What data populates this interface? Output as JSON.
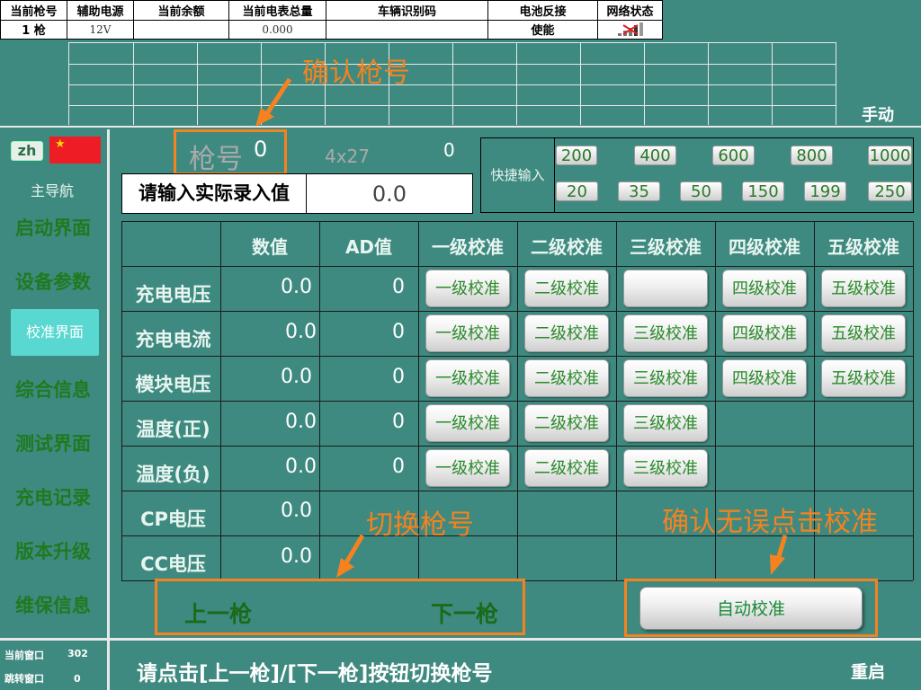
{
  "status": {
    "headers": [
      "当前枪号",
      "辅助电源",
      "当前余额",
      "当前电表总量",
      "车辆识别码",
      "电池反接",
      "网络状态"
    ],
    "gun": "1   枪",
    "aux_power": "12V",
    "balance": "",
    "meter_total": "0.000",
    "vin": "",
    "battery_reverse": "使能"
  },
  "upper": {
    "mode": "手动"
  },
  "sidebar": {
    "lang": "zh",
    "title": "主导航",
    "items": [
      {
        "label": "启动界面"
      },
      {
        "label": "设备参数"
      },
      {
        "label": "校准界面"
      },
      {
        "label": "综合信息"
      },
      {
        "label": "测试界面"
      },
      {
        "label": "充电记录"
      },
      {
        "label": "版本升级"
      },
      {
        "label": "维保信息"
      }
    ]
  },
  "main": {
    "gun_label": "枪号",
    "gun_value": "0",
    "size_label": "4x27",
    "zero_value": "0",
    "input_label": "请输入实际录入值",
    "input_value": "0.0",
    "quick_label": "快捷输入",
    "quick_row1": [
      "200",
      "400",
      "600",
      "800",
      "1000"
    ],
    "quick_row2": [
      "20",
      "35",
      "50",
      "150",
      "199",
      "250"
    ]
  },
  "table": {
    "headers": [
      "数值",
      "AD值",
      "一级校准",
      "二级校准",
      "三级校准",
      "四级校准",
      "五级校准"
    ],
    "rows": [
      {
        "label": "充电电压",
        "value": "0.0",
        "ad": "0",
        "btns": [
          "一级校准",
          "二级校准",
          "",
          "四级校准",
          "五级校准"
        ]
      },
      {
        "label": "充电电流",
        "value": "0.0",
        "ad": "0",
        "btns": [
          "一级校准",
          "二级校准",
          "三级校准",
          "四级校准",
          "五级校准"
        ]
      },
      {
        "label": "模块电压",
        "value": "0.0",
        "ad": "0",
        "btns": [
          "一级校准",
          "二级校准",
          "三级校准",
          "四级校准",
          "五级校准"
        ]
      },
      {
        "label": "温度(正)",
        "value": "0.0",
        "ad": "0",
        "btns": [
          "一级校准",
          "二级校准",
          "三级校准"
        ]
      },
      {
        "label": "温度(负)",
        "value": "0.0",
        "ad": "0",
        "btns": [
          "一级校准",
          "二级校准",
          "三级校准"
        ]
      },
      {
        "label": "CP电压",
        "value": "0.0",
        "ad": "",
        "btns": []
      },
      {
        "label": "CC电压",
        "value": "0.0",
        "ad": "",
        "btns": []
      }
    ]
  },
  "controls": {
    "prev": "上一枪",
    "next": "下一枪",
    "auto": "自动校准"
  },
  "annotations": {
    "confirm_gun": "确认枪号",
    "switch_gun": "切换枪号",
    "confirm_click": "确认无误点击校准"
  },
  "bottom": {
    "current_window_label": "当前窗口",
    "current_window_value": "302",
    "jump_window_label": "跳转窗口",
    "jump_window_value": "0",
    "hint": "请点击[上一枪]/[下一枪]按钮切换枪号",
    "restart": "重启"
  },
  "colors": {
    "background": "#3f8a80",
    "annotation": "#f5821f",
    "nav_text": "#1f7a1f",
    "active_nav": "#58d8d0"
  }
}
